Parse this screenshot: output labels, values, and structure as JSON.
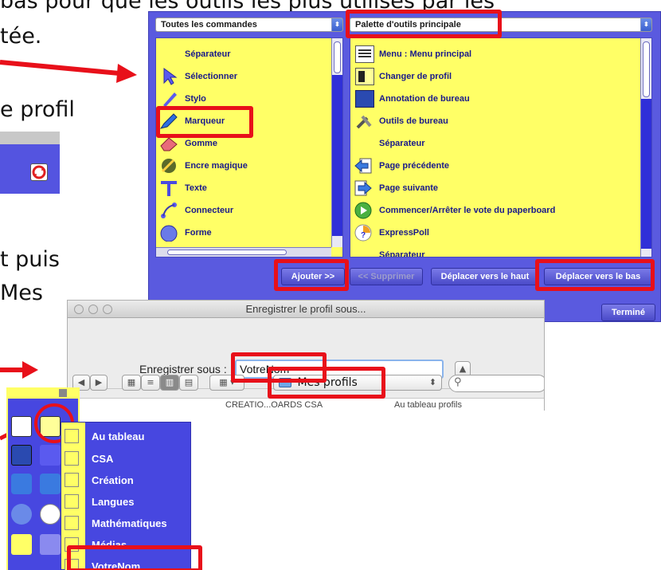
{
  "instructions": {
    "line_1": "bas pour que les outils les plus utilisés par les",
    "line_2": "tée.",
    "line_3": "e profil",
    "line_4": "t puis",
    "line_5": "Mes"
  },
  "editor": {
    "left_dropdown": "Toutes les commandes",
    "right_dropdown": "Palette d'outils principale",
    "all_commands": [
      {
        "label": "Séparateur",
        "icon": "none"
      },
      {
        "label": "Sélectionner",
        "icon": "select-cursor-icon"
      },
      {
        "label": "Stylo",
        "icon": "pen-icon"
      },
      {
        "label": "Marqueur",
        "icon": "marker-icon"
      },
      {
        "label": "Gomme",
        "icon": "eraser-icon"
      },
      {
        "label": "Encre magique",
        "icon": "magic-ink-icon"
      },
      {
        "label": "Texte",
        "icon": "text-icon"
      },
      {
        "label": "Connecteur",
        "icon": "connector-icon"
      },
      {
        "label": "Forme",
        "icon": "shape-icon"
      }
    ],
    "palette_items": [
      {
        "label": "Menu : Menu principal",
        "icon": "main-menu-icon"
      },
      {
        "label": "Changer de profil",
        "icon": "change-profile-icon"
      },
      {
        "label": "Annotation de bureau",
        "icon": "desktop-annotation-icon"
      },
      {
        "label": "Outils de bureau",
        "icon": "desktop-tools-icon"
      },
      {
        "label": "Séparateur",
        "icon": "none"
      },
      {
        "label": "Page précédente",
        "icon": "previous-page-icon"
      },
      {
        "label": "Page suivante",
        "icon": "next-page-icon"
      },
      {
        "label": "Commencer/Arrêter le vote du paperboard",
        "icon": "vote-icon"
      },
      {
        "label": "ExpressPoll",
        "icon": "expresspoll-icon"
      },
      {
        "label": "Séparateur",
        "icon": "none"
      }
    ],
    "buttons": {
      "add": "Ajouter >>",
      "remove": "<< Supprimer",
      "move_up": "Déplacer vers le haut",
      "move_down": "Déplacer vers le bas",
      "done": "Terminé"
    }
  },
  "save_dialog": {
    "title": "Enregistrer le profil sous...",
    "save_as_label": "Enregistrer sous :",
    "filename_value": "VotreNom",
    "location": "Mes profils",
    "search_placeholder": "",
    "partial_items": [
      "CREATIO...OARDS CSA",
      "Au tableau profils"
    ]
  },
  "profile_menu": {
    "items": [
      "Au tableau",
      "CSA",
      "Création",
      "Langues",
      "Mathématiques",
      "Médias",
      "VotreNom"
    ]
  },
  "colors": {
    "highlight_red": "#e8101a",
    "app_blue": "#4747e0",
    "list_yellow": "#ffff66",
    "label_navy": "#1a1a8a"
  }
}
